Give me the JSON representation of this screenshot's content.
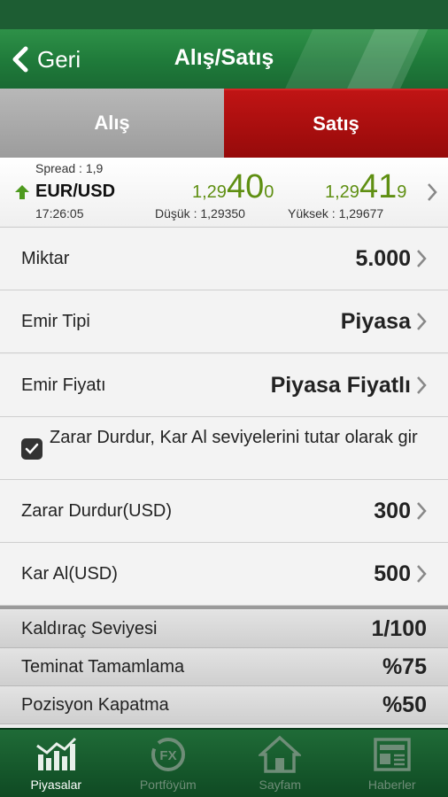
{
  "nav": {
    "back_label": "Geri",
    "title": "Alış/Satış"
  },
  "segment": {
    "buy_label": "Alış",
    "sell_label": "Satış"
  },
  "quote": {
    "spread": "Spread : 1,9",
    "pair": "EUR/USD",
    "time": "17:26:05",
    "bid": {
      "prefix": "1,29",
      "big": "40",
      "suffix": "0"
    },
    "ask": {
      "prefix": "1,29",
      "big": "41",
      "suffix": "9"
    },
    "low": "Düşük :  1,29350",
    "high": "Yüksek : 1,29677"
  },
  "form": {
    "amount": {
      "label": "Miktar",
      "value": "5.000"
    },
    "order_type": {
      "label": "Emir Tipi",
      "value": "Piyasa"
    },
    "order_price": {
      "label": "Emir Fiyatı",
      "value": "Piyasa Fiyatlı"
    },
    "checkbox_text": "Zarar Durdur, Kar Al seviyelerini tutar olarak gir",
    "stop_loss": {
      "label": "Zarar Durdur(USD)",
      "value": "300"
    },
    "take_profit": {
      "label": "Kar Al(USD)",
      "value": "500"
    }
  },
  "info": {
    "leverage": {
      "label": "Kaldıraç Seviyesi",
      "value": "1/100"
    },
    "margin_call": {
      "label": "Teminat Tamamlama",
      "value": "%75"
    },
    "stop_out": {
      "label": "Pozisyon Kapatma",
      "value": "%50"
    }
  },
  "tabs": [
    "Piyasalar",
    "Portföyüm",
    "Sayfam",
    "Haberler"
  ],
  "colors": {
    "nav_green": "#1f7a3a",
    "sell_red": "#b01010",
    "price_green": "#5f8f12",
    "tab_green": "#0f4a23"
  }
}
